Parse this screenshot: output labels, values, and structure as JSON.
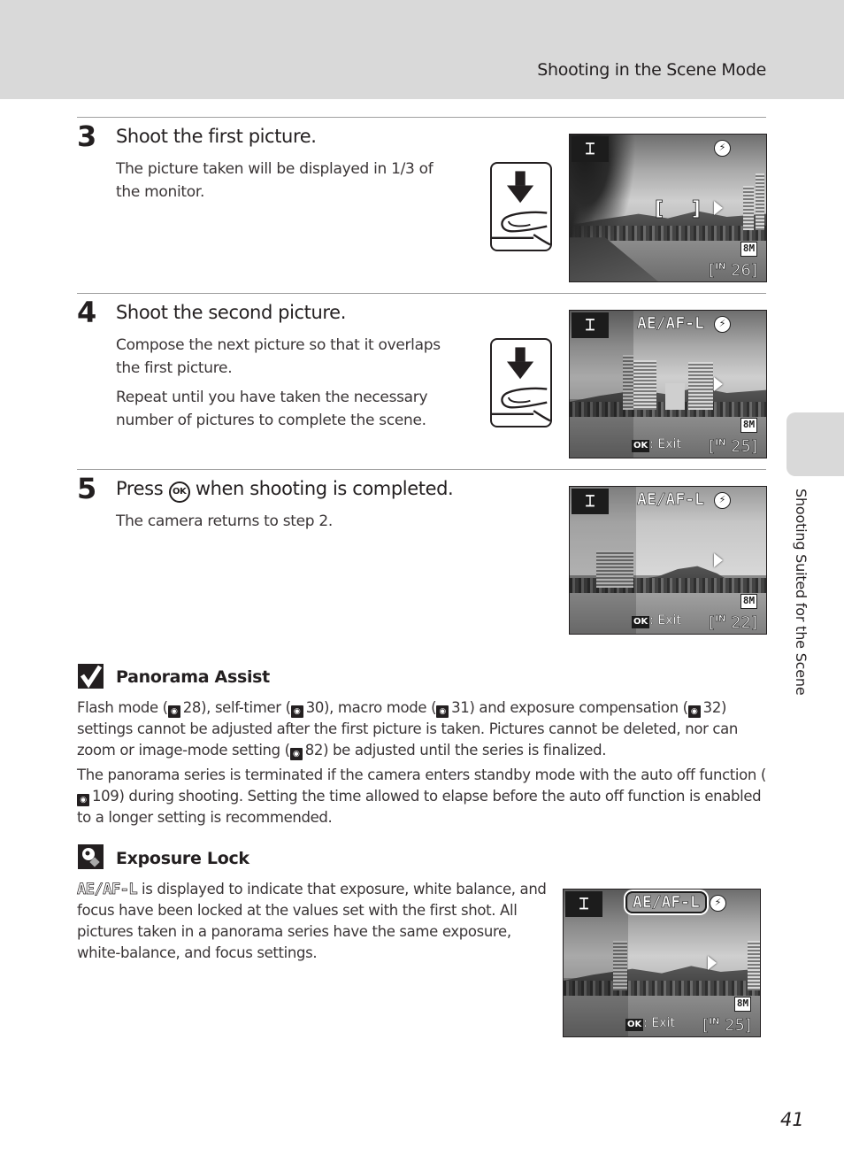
{
  "header": {
    "title": "Shooting in the Scene Mode"
  },
  "side_tab": {
    "label": "Shooting Suited for the Scene"
  },
  "steps": [
    {
      "number": "3",
      "title": "Shoot the first picture.",
      "body": [
        "The picture taken will be displayed in 1/3 of the monitor."
      ],
      "screen": {
        "mode_icon": "panorama-icon",
        "show_aeaf": false,
        "focus_bracket": "[ ]",
        "size": "8M",
        "memory": "IN",
        "count": "26",
        "ok_exit": ""
      }
    },
    {
      "number": "4",
      "title": "Shoot the second picture.",
      "body": [
        "Compose the next picture so that it overlaps the first picture.",
        "Repeat until you have taken the necessary number of pictures to complete the scene."
      ],
      "screen": {
        "mode_icon": "panorama-icon",
        "aeaf_label": "AE/AF-L",
        "size": "8M",
        "memory": "IN",
        "count": "25",
        "ok_key": "OK",
        "ok_exit": ": Exit"
      }
    },
    {
      "number": "5",
      "title_before": "Press",
      "title_key": "OK",
      "title_after": "when shooting is completed.",
      "body": [
        "The camera returns to step 2."
      ],
      "screen": {
        "mode_icon": "panorama-icon",
        "aeaf_label": "AE/AF-L",
        "size": "8M",
        "memory": "IN",
        "count": "22",
        "ok_key": "OK",
        "ok_exit": ": Exit"
      }
    }
  ],
  "notes": {
    "panorama_assist": {
      "icon": "checkmark-icon",
      "title": "Panorama Assist",
      "para1": {
        "t1": "Flash mode (",
        "r1": "28",
        "t2": "), self-timer (",
        "r2": "30",
        "t3": "), macro mode (",
        "r3": "31",
        "t4": ") and exposure compensation (",
        "r4": "32",
        "t5": ") settings cannot be adjusted after the first picture is taken. Pictures cannot be deleted, nor can zoom or image-mode setting (",
        "r5": "82",
        "t6": ") be adjusted until the series is finalized."
      },
      "para2": {
        "t1": "The panorama series is terminated if the camera enters standby mode with the auto off function (",
        "r1": "109",
        "t2": ") during shooting. Setting the time allowed to elapse before the auto off function is enabled to a longer setting is recommended."
      }
    },
    "exposure_lock": {
      "icon": "lightbulb-icon",
      "title": "Exposure Lock",
      "aeaf_label": "AE/AF-L",
      "body": " is displayed to indicate that exposure, white balance, and focus have been locked at the values set with the first shot. All pictures taken in a panorama series have the same exposure, white-balance, and focus settings.",
      "screen": {
        "mode_icon": "panorama-icon",
        "aeaf_label": "AE/AF-L",
        "size": "8M",
        "memory": "IN",
        "count": "25",
        "ok_key": "OK",
        "ok_exit": ": Exit"
      }
    }
  },
  "page_number": "41"
}
